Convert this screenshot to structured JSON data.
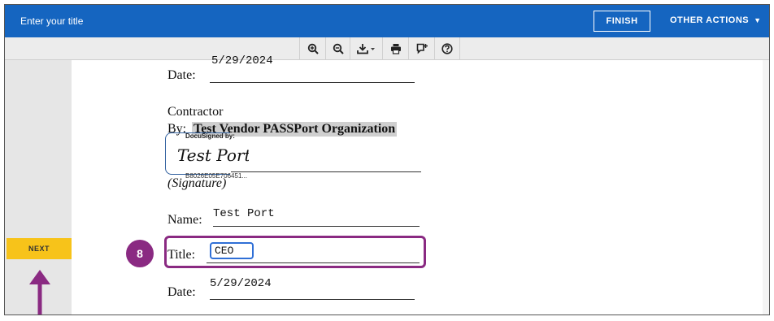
{
  "header": {
    "title_placeholder": "Enter your title",
    "finish_label": "FINISH",
    "other_actions_label": "OTHER ACTIONS",
    "other_actions_caret": "▼"
  },
  "toolbar": {
    "tools": [
      "zoom-in",
      "zoom-out",
      "download",
      "print",
      "comment",
      "help"
    ]
  },
  "sidebar": {
    "next_label": "NEXT"
  },
  "step": {
    "number": "8"
  },
  "document": {
    "date_label_top": "Date:",
    "date_value_top": "5/29/2024",
    "contractor_label": "Contractor",
    "by_label": "By:",
    "organization": "Test Vendor PASSPort Organization",
    "docusigned_by": "DocuSigned by:",
    "signature_text": "Test Port",
    "envelope_id": "B8026E05E706451...",
    "signature_caption": "(Signature)",
    "name_label": "Name:",
    "name_value": "Test Port",
    "title_label": "Title:",
    "title_value": "CEO",
    "date_label_bottom": "Date:",
    "date_value_bottom": "5/29/2024"
  },
  "colors": {
    "header_bg": "#1565c0",
    "next_button": "#f7c31a",
    "step_highlight": "#8a2a82",
    "input_focus": "#2f6fd6"
  }
}
